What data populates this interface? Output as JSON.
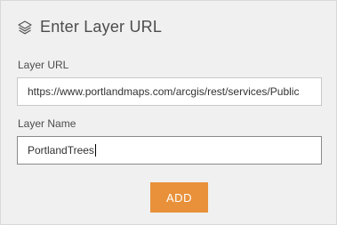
{
  "header": {
    "title": "Enter Layer URL",
    "icon": "layers-icon"
  },
  "layer_url": {
    "label": "Layer URL",
    "value": "https://www.portlandmaps.com/arcgis/rest/services/Public"
  },
  "layer_name": {
    "label": "Layer Name",
    "value": "PortlandTrees"
  },
  "add_button": {
    "label": "ADD",
    "color": "#e8913a"
  }
}
